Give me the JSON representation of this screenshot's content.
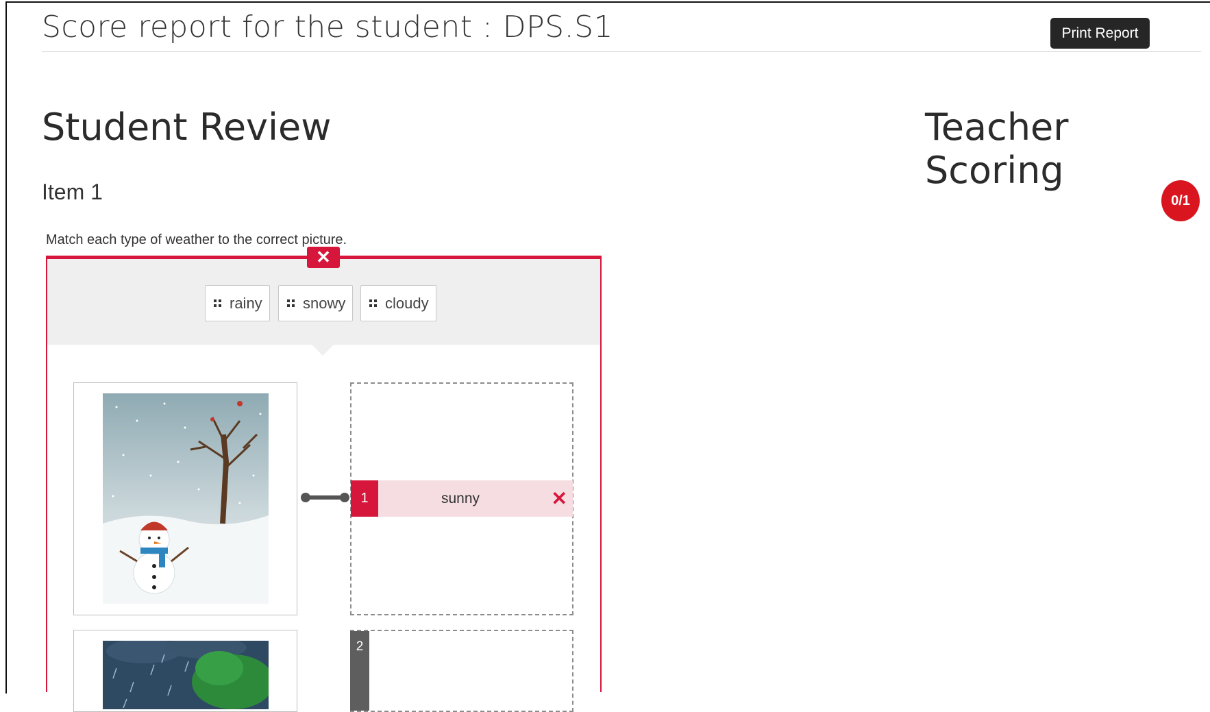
{
  "header": {
    "title": "Score report for the student : DPS.S1",
    "print_label": "Print Report"
  },
  "sections": {
    "student_review": "Student Review",
    "teacher_scoring": "Teacher Scoring"
  },
  "item": {
    "label": "Item 1",
    "score": "0/1",
    "instruction": "Match each type of weather to the correct picture.",
    "status_icon": "close-icon",
    "choices": [
      {
        "label": "rainy"
      },
      {
        "label": "snowy"
      },
      {
        "label": "cloudy"
      }
    ],
    "matches": [
      {
        "number": "1",
        "answer": "sunny",
        "image": "snowman-in-snow-image",
        "result": "incorrect"
      },
      {
        "number": "2",
        "answer": "",
        "image": "rainy-tree-image",
        "result": ""
      }
    ]
  },
  "colors": {
    "incorrect": "#d6163b",
    "badge": "#d9151f",
    "button": "#262626"
  }
}
